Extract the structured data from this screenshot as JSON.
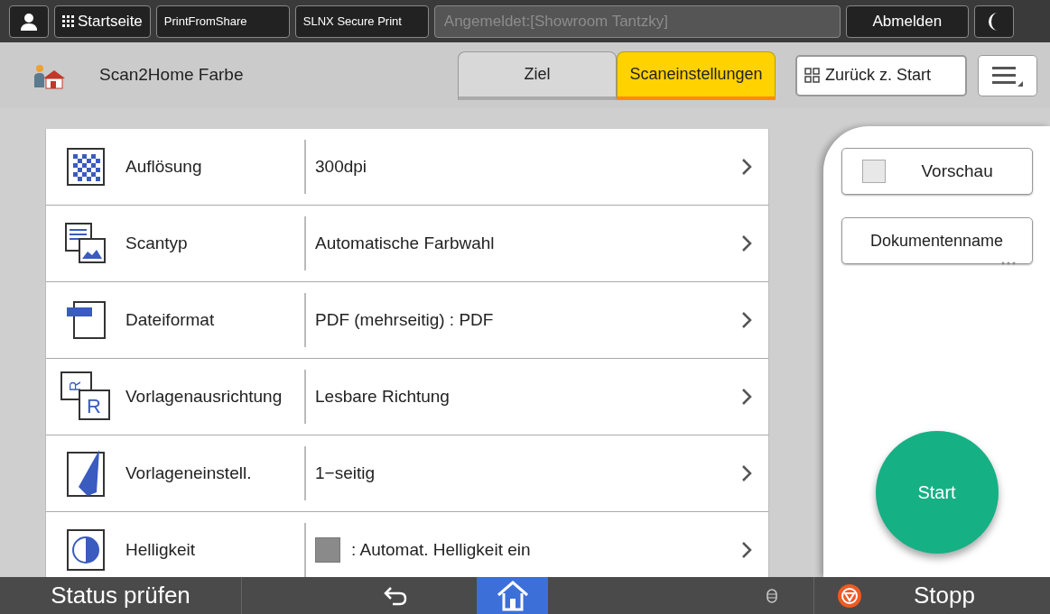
{
  "top_bar": {
    "home_label": "Startseite",
    "apps": [
      "PrintFromShare",
      "SLNX Secure Print"
    ],
    "login_field": "Angemeldet:[Showroom Tantzky]",
    "logout": "Abmelden"
  },
  "header": {
    "title": "Scan2Home Farbe",
    "tabs": [
      {
        "label": "Ziel",
        "selected": false
      },
      {
        "label": "Scaneinstellungen",
        "selected": true
      }
    ],
    "back_button": "Zurück z. Start"
  },
  "settings": [
    {
      "kind": "resolution",
      "label": "Auflösung",
      "value": "300dpi"
    },
    {
      "kind": "scantype",
      "label": "Scantyp",
      "value": "Automatische Farbwahl"
    },
    {
      "kind": "fileformat",
      "label": "Dateiformat",
      "value": "PDF (mehrseitig) : PDF"
    },
    {
      "kind": "orientation",
      "icon_letters": [
        "R",
        "R"
      ],
      "label": "Vorlagenausrichtung",
      "value": "Lesbare Richtung"
    },
    {
      "kind": "original",
      "label": "Vorlageneinstell.",
      "value": "1−seitig"
    },
    {
      "kind": "brightness",
      "label": "Helligkeit",
      "value": ": Automat. Helligkeit ein",
      "swatch": true
    }
  ],
  "side_panel": {
    "preview": {
      "label": "Vorschau",
      "checked": false
    },
    "document_name": "Dokumentenname",
    "start": "Start"
  },
  "bottom_bar": {
    "status": "Status prüfen",
    "stop": "Stopp"
  }
}
